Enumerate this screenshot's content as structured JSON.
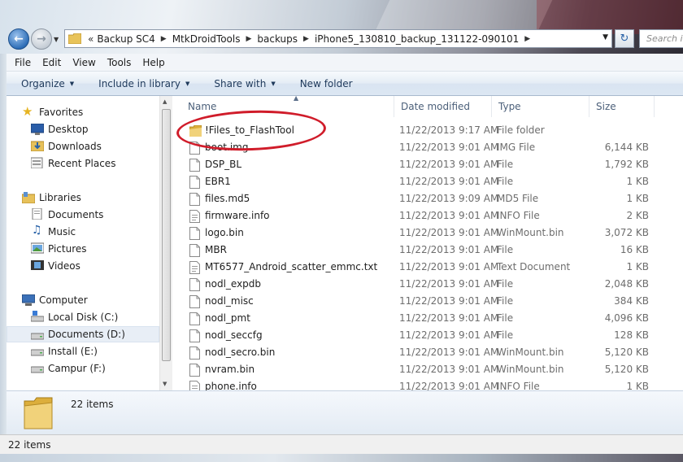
{
  "address": {
    "overflow_chevron": "«",
    "crumbs": [
      "Backup SC4",
      "MtkDroidTools",
      "backups",
      "iPhone5_130810_backup_131122-090101"
    ],
    "search_placeholder": "Search iP"
  },
  "menu": [
    "File",
    "Edit",
    "View",
    "Tools",
    "Help"
  ],
  "toolbar": {
    "organize": "Organize",
    "include_in_library": "Include in library",
    "share_with": "Share with",
    "new_folder": "New folder"
  },
  "nav": {
    "favorites": {
      "label": "Favorites",
      "items": [
        "Desktop",
        "Downloads",
        "Recent Places"
      ]
    },
    "libraries": {
      "label": "Libraries",
      "items": [
        "Documents",
        "Music",
        "Pictures",
        "Videos"
      ]
    },
    "computer": {
      "label": "Computer",
      "items": [
        "Local Disk (C:)",
        "Documents (D:)",
        "Install (E:)",
        "Campur (F:)"
      ]
    },
    "selected": "Documents (D:)"
  },
  "columns": {
    "name": "Name",
    "date": "Date modified",
    "type": "Type",
    "size": "Size"
  },
  "files": [
    {
      "name": "!Files_to_FlashTool",
      "date": "11/22/2013 9:17 AM",
      "type": "File folder",
      "size": "",
      "icon": "folder-icon"
    },
    {
      "name": "boot.img",
      "date": "11/22/2013 9:01 AM",
      "type": "IMG File",
      "size": "6,144 KB",
      "icon": "file-icon"
    },
    {
      "name": "DSP_BL",
      "date": "11/22/2013 9:01 AM",
      "type": "File",
      "size": "1,792 KB",
      "icon": "file-icon"
    },
    {
      "name": "EBR1",
      "date": "11/22/2013 9:01 AM",
      "type": "File",
      "size": "1 KB",
      "icon": "file-icon"
    },
    {
      "name": "files.md5",
      "date": "11/22/2013 9:09 AM",
      "type": "MD5 File",
      "size": "1 KB",
      "icon": "file-icon"
    },
    {
      "name": "firmware.info",
      "date": "11/22/2013 9:01 AM",
      "type": "INFO File",
      "size": "2 KB",
      "icon": "text-file-icon"
    },
    {
      "name": "logo.bin",
      "date": "11/22/2013 9:01 AM",
      "type": "WinMount.bin",
      "size": "3,072 KB",
      "icon": "file-icon"
    },
    {
      "name": "MBR",
      "date": "11/22/2013 9:01 AM",
      "type": "File",
      "size": "16 KB",
      "icon": "file-icon"
    },
    {
      "name": "MT6577_Android_scatter_emmc.txt",
      "date": "11/22/2013 9:01 AM",
      "type": "Text Document",
      "size": "1 KB",
      "icon": "text-file-icon"
    },
    {
      "name": "nodl_expdb",
      "date": "11/22/2013 9:01 AM",
      "type": "File",
      "size": "2,048 KB",
      "icon": "file-icon"
    },
    {
      "name": "nodl_misc",
      "date": "11/22/2013 9:01 AM",
      "type": "File",
      "size": "384 KB",
      "icon": "file-icon"
    },
    {
      "name": "nodl_pmt",
      "date": "11/22/2013 9:01 AM",
      "type": "File",
      "size": "4,096 KB",
      "icon": "file-icon"
    },
    {
      "name": "nodl_seccfg",
      "date": "11/22/2013 9:01 AM",
      "type": "File",
      "size": "128 KB",
      "icon": "file-icon"
    },
    {
      "name": "nodl_secro.bin",
      "date": "11/22/2013 9:01 AM",
      "type": "WinMount.bin",
      "size": "5,120 KB",
      "icon": "file-icon"
    },
    {
      "name": "nvram.bin",
      "date": "11/22/2013 9:01 AM",
      "type": "WinMount.bin",
      "size": "5,120 KB",
      "icon": "file-icon"
    },
    {
      "name": "phone.info",
      "date": "11/22/2013 9:01 AM",
      "type": "INFO File",
      "size": "1 KB",
      "icon": "text-file-icon"
    }
  ],
  "details": {
    "count": "22 items"
  },
  "status": {
    "count": "22 items"
  },
  "colors": {
    "highlight_ellipse": "#d01c2a",
    "selection": "#e8eef6",
    "link_text": "#1e395b"
  }
}
